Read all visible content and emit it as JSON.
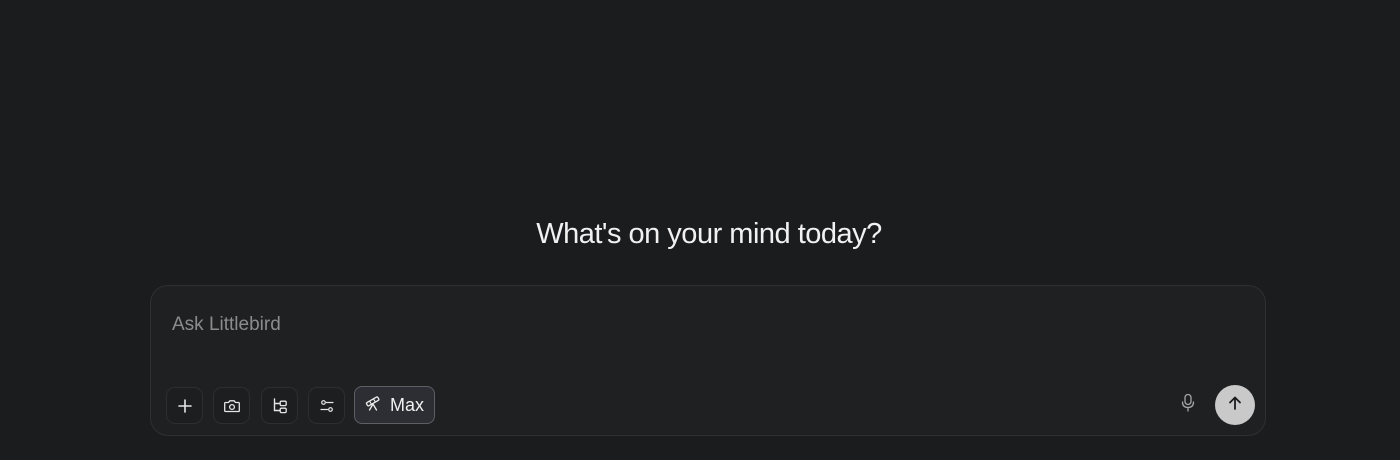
{
  "heading": {
    "text": "What's on your mind today?"
  },
  "composer": {
    "placeholder": "Ask Littlebird",
    "value": "",
    "toolbar": {
      "attach": {
        "icon": "plus-icon"
      },
      "screenshot": {
        "icon": "camera-icon"
      },
      "context": {
        "icon": "hierarchy-icon"
      },
      "settings": {
        "icon": "sliders-icon"
      },
      "mode": {
        "icon": "telescope-icon",
        "label": "Max"
      }
    },
    "mic": {
      "icon": "microphone-icon"
    },
    "send": {
      "icon": "arrow-up-icon"
    }
  },
  "colors": {
    "background": "#1b1c1e",
    "composer_bg": "#1f2022",
    "mode_active_bg": "#2c2e33",
    "send_bg": "#c9c9c9",
    "text": "#f1f1f1",
    "placeholder": "#8b8c8f"
  }
}
